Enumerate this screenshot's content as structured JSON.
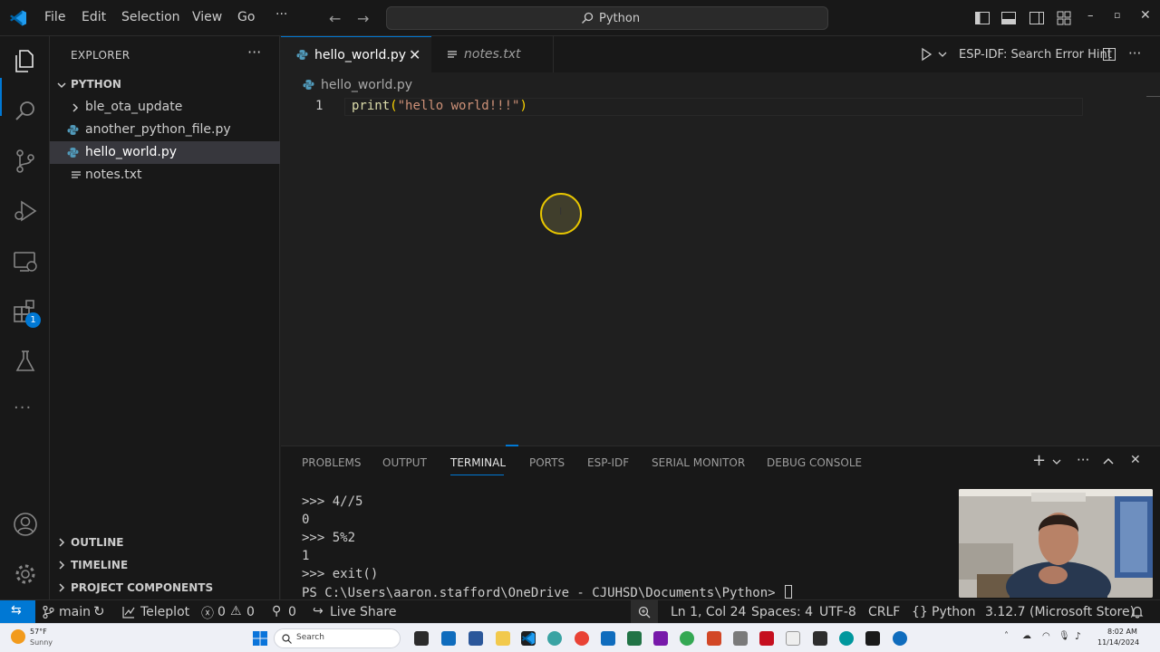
{
  "titlebar": {
    "menu": [
      "File",
      "Edit",
      "Selection",
      "View",
      "Go"
    ],
    "overflow": "···",
    "command_center": "Python"
  },
  "sidebar": {
    "title": "EXPLORER",
    "more": "···",
    "folder": "PYTHON",
    "items": [
      {
        "label": "ble_ota_update",
        "type": "folder"
      },
      {
        "label": "another_python_file.py",
        "type": "python"
      },
      {
        "label": "hello_world.py",
        "type": "python",
        "selected": true
      },
      {
        "label": "notes.txt",
        "type": "text"
      }
    ],
    "sections": [
      "OUTLINE",
      "TIMELINE",
      "PROJECT COMPONENTS"
    ]
  },
  "activity_bar": {
    "icons": [
      "files-icon",
      "search-icon",
      "source-control-icon",
      "run-debug-icon",
      "remote-explorer-icon",
      "extensions-icon",
      "testing-icon",
      "more-icon",
      "account-icon",
      "settings-gear-icon"
    ],
    "extensions_badge": "1"
  },
  "tabs": [
    {
      "label": "hello_world.py",
      "active": true
    },
    {
      "label": "notes.txt",
      "active": false
    }
  ],
  "editor_actions": {
    "hint": "ESP-IDF: Search Error Hint"
  },
  "editor": {
    "breadcrumb": "hello_world.py",
    "line_number": "1",
    "code": {
      "fn": "print",
      "open": "(",
      "str": "\"hello world!!!\"",
      "close": ")"
    }
  },
  "panel": {
    "tabs": [
      "PROBLEMS",
      "OUTPUT",
      "TERMINAL",
      "PORTS",
      "ESP-IDF",
      "SERIAL MONITOR",
      "DEBUG CONSOLE"
    ],
    "active_tab": "TERMINAL",
    "terminal_lines": [
      ">>> 4//5",
      "0",
      ">>> 5%2",
      "1",
      ">>> exit()"
    ],
    "prompt": "PS C:\\Users\\aaron.stafford\\OneDrive - CJUHSD\\Documents\\Python>"
  },
  "statusbar": {
    "branch": "main",
    "teleplot": "Teleplot",
    "errors": "0",
    "warnings": "0",
    "ports": "0",
    "live_share": "Live Share",
    "position": "Ln 1, Col 24",
    "spaces": "Spaces: 4",
    "encoding": "UTF-8",
    "eol": "CRLF",
    "language_braces": "{}",
    "language": "Python",
    "interpreter": "3.12.7 (Microsoft Store)"
  },
  "taskbar": {
    "weather_temp": "57°F",
    "weather_cond": "Sunny",
    "search": "Search",
    "time": "8:02 AM",
    "date": "11/14/2024"
  },
  "colors": {
    "accent": "#0078d4",
    "string": "#ce9178",
    "function": "#dcdcaa",
    "bracket": "#ffd700",
    "python_icon": "#519aba"
  }
}
